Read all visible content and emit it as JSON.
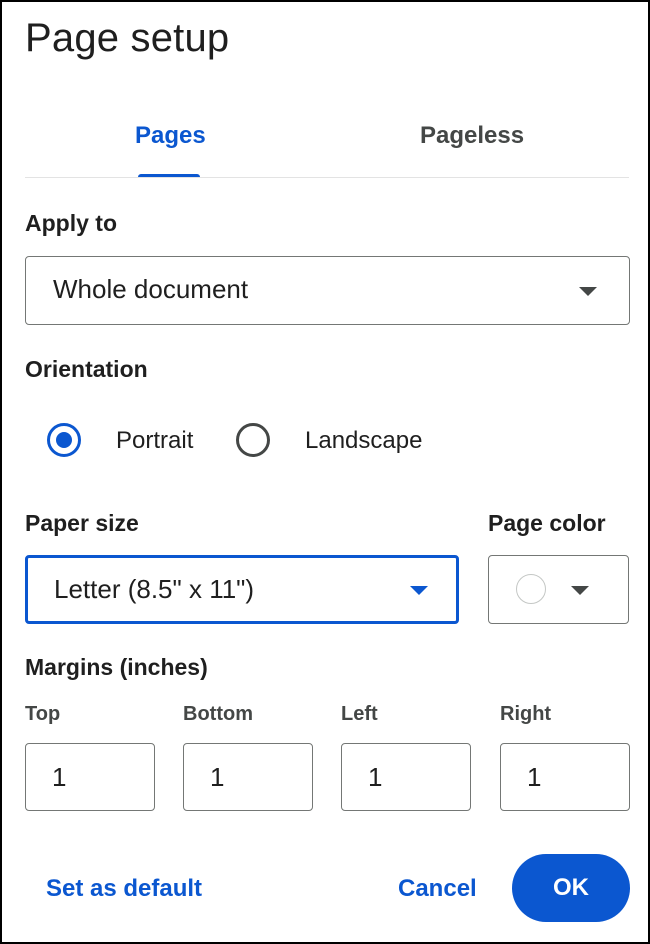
{
  "dialog": {
    "title": "Page setup"
  },
  "tabs": [
    {
      "label": "Pages",
      "active": true
    },
    {
      "label": "Pageless",
      "active": false
    }
  ],
  "apply_to": {
    "label": "Apply to",
    "value": "Whole document"
  },
  "orientation": {
    "label": "Orientation",
    "options": [
      {
        "label": "Portrait",
        "selected": true
      },
      {
        "label": "Landscape",
        "selected": false
      }
    ]
  },
  "paper_size": {
    "label": "Paper size",
    "value": "Letter (8.5\" x 11\")"
  },
  "page_color": {
    "label": "Page color",
    "value": "#ffffff"
  },
  "margins": {
    "label": "Margins (inches)",
    "fields": [
      {
        "label": "Top",
        "value": "1"
      },
      {
        "label": "Bottom",
        "value": "1"
      },
      {
        "label": "Left",
        "value": "1"
      },
      {
        "label": "Right",
        "value": "1"
      }
    ]
  },
  "actions": {
    "set_default": "Set as default",
    "cancel": "Cancel",
    "ok": "OK"
  },
  "colors": {
    "accent": "#0b57d0",
    "text": "#1f1f1f",
    "muted": "#444746"
  }
}
